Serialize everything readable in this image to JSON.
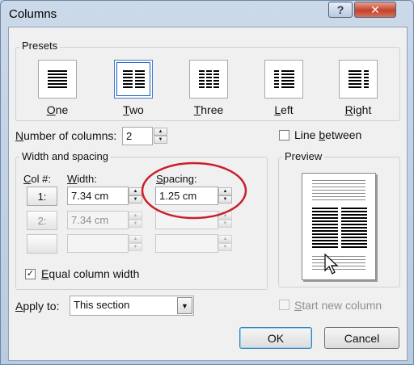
{
  "window": {
    "title": "Columns",
    "help_glyph": "?",
    "close_glyph": "✕"
  },
  "presets": {
    "group_label": "Presets",
    "items": [
      {
        "label": "One",
        "underline": "O",
        "rest": "ne"
      },
      {
        "label": "Two",
        "underline": "T",
        "rest": "wo",
        "selected": true
      },
      {
        "label": "Three",
        "underline": "T",
        "rest": "hree"
      },
      {
        "label": "Left",
        "underline": "L",
        "rest": "eft"
      },
      {
        "label": "Right",
        "underline": "R",
        "rest": "ight"
      }
    ]
  },
  "num_columns": {
    "label_u": "N",
    "label_rest": "umber of columns:",
    "value": "2"
  },
  "line_between": {
    "label_pre": "Line ",
    "label_u": "b",
    "label_post": "etween",
    "checked": false
  },
  "width_spacing": {
    "group_label": "Width and spacing",
    "col_header_u": "C",
    "col_header_rest": "ol #:",
    "width_header_u": "W",
    "width_header_rest": "idth:",
    "spacing_header_u": "S",
    "spacing_header_rest": "pacing:",
    "rows": [
      {
        "col": "1:",
        "width": "7.34 cm",
        "spacing": "1.25 cm",
        "enabled": true
      },
      {
        "col": "2:",
        "width": "7.34 cm",
        "spacing": "",
        "enabled": false
      },
      {
        "col": "",
        "width": "",
        "spacing": "",
        "enabled": false
      }
    ]
  },
  "equal_width": {
    "label_u": "E",
    "label_rest": "qual column width",
    "checked": true,
    "check_glyph": "✓"
  },
  "preview": {
    "group_label": "Preview"
  },
  "apply_to": {
    "label_u": "A",
    "label_rest": "pply to:",
    "value": "This section",
    "arrow": "▼"
  },
  "start_new_column": {
    "label_u": "S",
    "label_rest": "tart new column",
    "checked": false,
    "enabled": false
  },
  "buttons": {
    "ok": "OK",
    "cancel": "Cancel"
  },
  "spin_glyphs": {
    "up": "▲",
    "down": "▼"
  },
  "colors": {
    "highlight_circle": "#c8202a",
    "selected_border": "#1d5fb8"
  }
}
